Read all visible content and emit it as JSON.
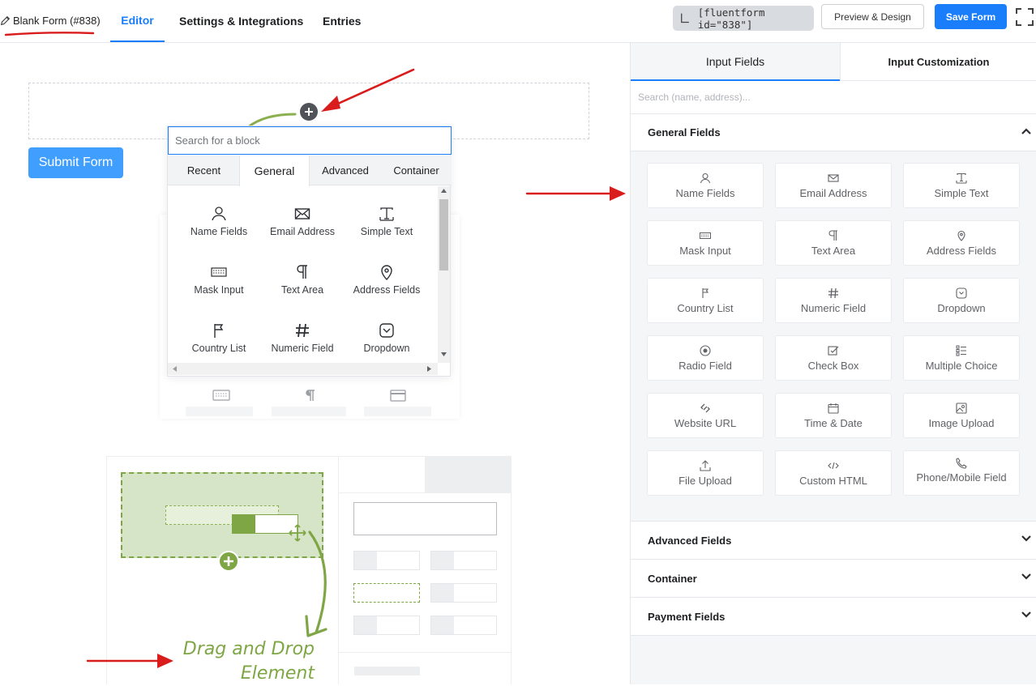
{
  "header": {
    "form_title": "Blank Form (#838)",
    "tabs": [
      {
        "label": "Editor",
        "active": true
      },
      {
        "label": "Settings & Integrations",
        "active": false
      },
      {
        "label": "Entries",
        "active": false
      }
    ],
    "shortcode": "[fluentform id=\"838\"]",
    "preview_label": "Preview & Design",
    "save_label": "Save Form"
  },
  "editor": {
    "submit_label": "Submit Form",
    "block_popup": {
      "search_placeholder": "Search for a block",
      "tabs": [
        "Recent",
        "General",
        "Advanced",
        "Container"
      ],
      "active_tab": "General",
      "items": [
        {
          "label": "Name Fields",
          "icon": "person-icon"
        },
        {
          "label": "Email Address",
          "icon": "envelope-icon"
        },
        {
          "label": "Simple Text",
          "icon": "text-icon"
        },
        {
          "label": "Mask Input",
          "icon": "keyboard-icon"
        },
        {
          "label": "Text Area",
          "icon": "paragraph-icon"
        },
        {
          "label": "Address Fields",
          "icon": "location-pin-icon"
        },
        {
          "label": "Country List",
          "icon": "flag-icon"
        },
        {
          "label": "Numeric Field",
          "icon": "hash-icon"
        },
        {
          "label": "Dropdown",
          "icon": "dropdown-icon"
        }
      ]
    },
    "drag_text_line1": "Drag and Drop",
    "drag_text_line2": "Element"
  },
  "right_panel": {
    "tabs": [
      "Input Fields",
      "Input Customization"
    ],
    "active_tab": "Input Fields",
    "search_placeholder": "Search (name, address)...",
    "general_title": "General Fields",
    "general_fields": [
      {
        "label": "Name Fields",
        "icon": "person-icon"
      },
      {
        "label": "Email Address",
        "icon": "envelope-icon"
      },
      {
        "label": "Simple Text",
        "icon": "text-icon"
      },
      {
        "label": "Mask Input",
        "icon": "keyboard-icon"
      },
      {
        "label": "Text Area",
        "icon": "paragraph-icon"
      },
      {
        "label": "Address Fields",
        "icon": "location-pin-icon"
      },
      {
        "label": "Country List",
        "icon": "flag-icon"
      },
      {
        "label": "Numeric Field",
        "icon": "hash-icon"
      },
      {
        "label": "Dropdown",
        "icon": "dropdown-icon"
      },
      {
        "label": "Radio Field",
        "icon": "radio-icon"
      },
      {
        "label": "Check Box",
        "icon": "checkbox-icon"
      },
      {
        "label": "Multiple Choice",
        "icon": "list-icon"
      },
      {
        "label": "Website URL",
        "icon": "link-icon"
      },
      {
        "label": "Time & Date",
        "icon": "calendar-icon"
      },
      {
        "label": "Image Upload",
        "icon": "image-icon"
      },
      {
        "label": "File Upload",
        "icon": "upload-icon"
      },
      {
        "label": "Custom HTML",
        "icon": "code-icon"
      },
      {
        "label": "Phone/Mobile Field",
        "icon": "phone-icon"
      }
    ],
    "sections": [
      "Advanced Fields",
      "Container",
      "Payment Fields"
    ]
  },
  "colors": {
    "accent": "#1a7efb",
    "annotation_red": "#d91c1c",
    "illustration_green": "#7fa645"
  }
}
